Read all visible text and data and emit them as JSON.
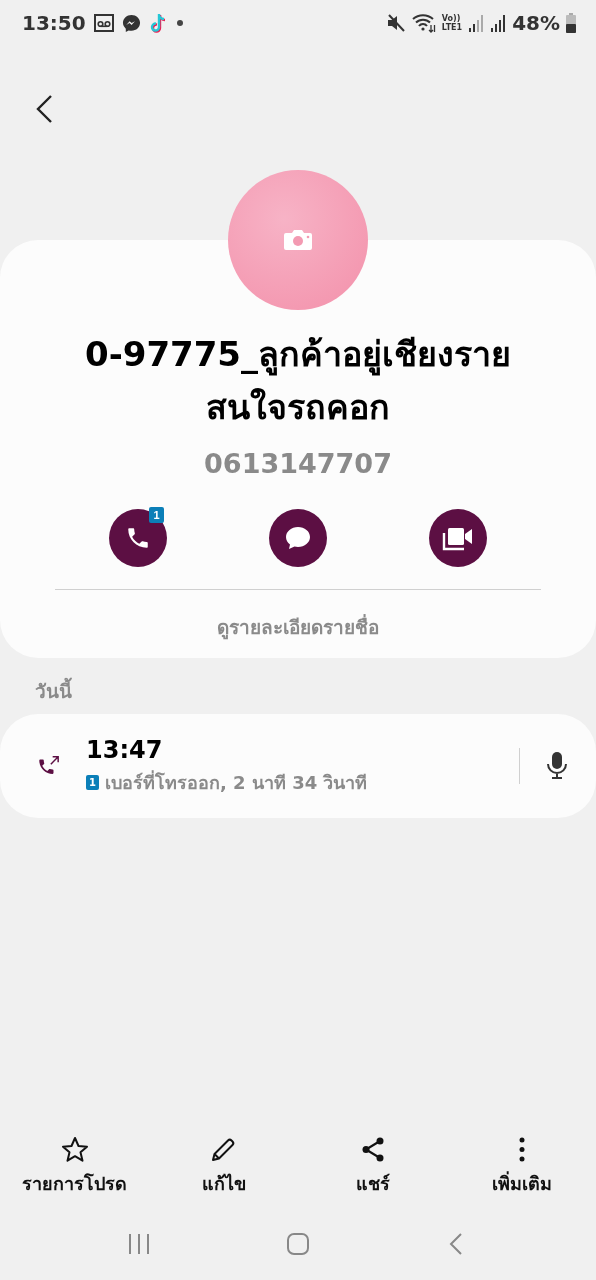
{
  "status_bar": {
    "time": "13:50",
    "volte": "Vo))",
    "lte": "LTE1",
    "battery": "48%"
  },
  "contact": {
    "name_lines": [
      "0-97775_ลูกค้าอยู่เชียงราย",
      "สนใจรถคอก"
    ],
    "phone": "0613147707",
    "call_badge": "1",
    "details_link": "ดูรายละเอียดรายชื่อ"
  },
  "history": {
    "section": "วันนี้",
    "calls": [
      {
        "time": "13:47",
        "sim": "1",
        "description": "เบอร์ที่โทรออก, 2 นาที 34 วินาที"
      }
    ]
  },
  "bottom_actions": [
    {
      "kind": "star",
      "label": "รายการโปรด"
    },
    {
      "kind": "edit",
      "label": "แก้ไข"
    },
    {
      "kind": "share",
      "label": "แชร์"
    },
    {
      "kind": "more",
      "label": "เพิ่มเติม"
    }
  ]
}
